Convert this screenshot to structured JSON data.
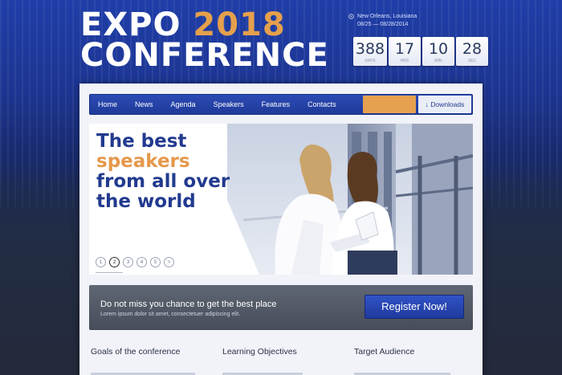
{
  "logo": {
    "line1_text": "EXPO",
    "year": "2018",
    "line2_text": "CONFERENCE"
  },
  "event": {
    "location": "New Orleans, Louisiana",
    "dates": "08/25 — 08/28/2014"
  },
  "countdown": {
    "items": [
      {
        "value": "388",
        "label": "days"
      },
      {
        "value": "17",
        "label": "hrs"
      },
      {
        "value": "10",
        "label": "min"
      },
      {
        "value": "28",
        "label": "sec"
      }
    ]
  },
  "nav": {
    "items": [
      "Home",
      "News",
      "Agenda",
      "Speakers",
      "Features",
      "Contacts"
    ],
    "downloads_label": "↓ Downloads"
  },
  "hero": {
    "line1": "The best",
    "line2": "speakers",
    "line3": "from all over",
    "line4": "the world",
    "pages": [
      "1",
      "2",
      "3",
      "4",
      "5",
      ">"
    ],
    "active_page": "2"
  },
  "cta": {
    "title": "Do not miss you chance to get the best place",
    "subtitle": "Lorem ipsum dolor sit amet, consectetuer adipiscing elit.",
    "button_label": "Register Now!"
  },
  "columns": {
    "col1_title": "Goals of the conference",
    "col2_title": "Learning Objectives",
    "col3_title": "Target Audience"
  },
  "colors": {
    "brand_blue": "#223a8f",
    "accent_orange": "#e5984a",
    "nav_blue": "#2c4bb5"
  }
}
